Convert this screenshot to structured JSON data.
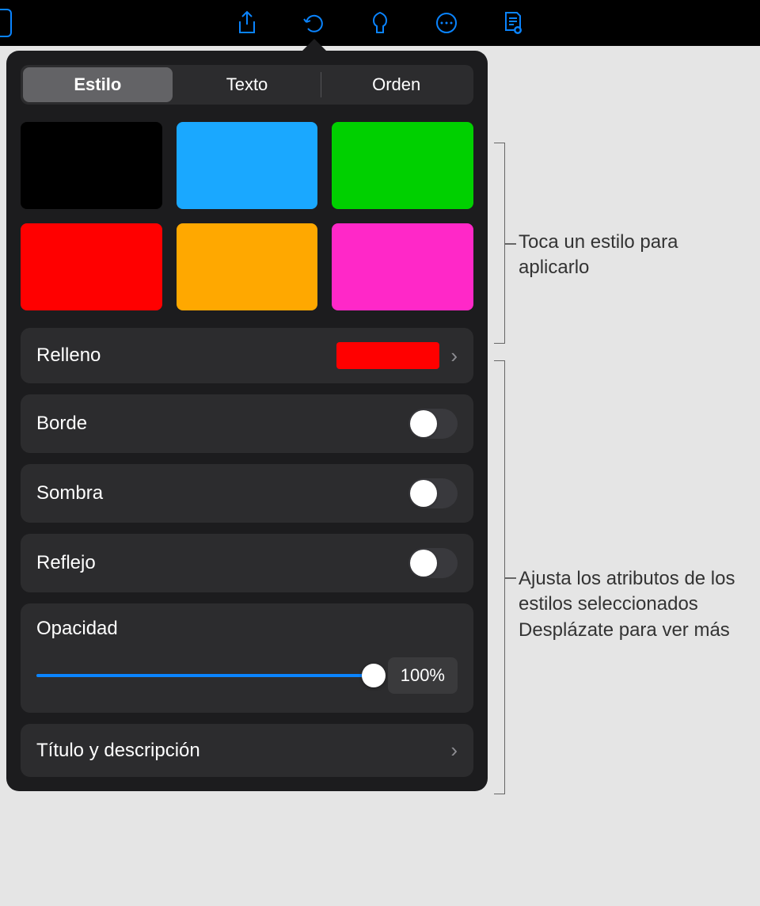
{
  "toolbar_icons": [
    "share-icon",
    "undo-icon",
    "format-brush-icon",
    "more-icon",
    "document-mode-icon"
  ],
  "tabs": {
    "style": "Estilo",
    "text": "Texto",
    "arrange": "Orden"
  },
  "swatches": [
    "#000000",
    "#1aa8ff",
    "#00d000",
    "#ff0000",
    "#ffa800",
    "#ff28c8"
  ],
  "rows": {
    "fill": "Relleno",
    "fill_color": "#ff0000",
    "border": "Borde",
    "shadow": "Sombra",
    "reflection": "Reflejo",
    "opacity": "Opacidad",
    "opacity_value": "100%",
    "title_desc": "Título y descripción"
  },
  "callouts": {
    "style_tap": "Toca un estilo para aplicarlo",
    "adjust": "Ajusta los atributos de los estilos seleccionados Desplázate para ver más"
  }
}
